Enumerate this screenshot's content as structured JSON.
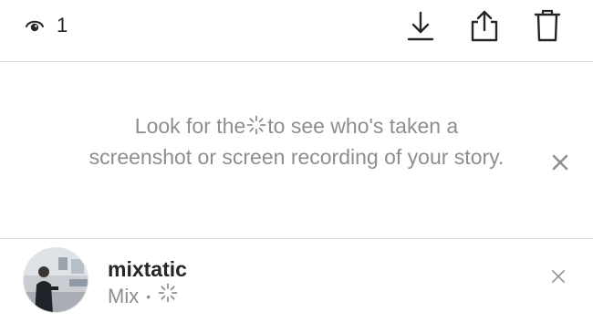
{
  "header": {
    "view_count": "1"
  },
  "notice": {
    "text_before": "Look for the",
    "text_after": "to see who's taken a screenshot or screen recording of your story."
  },
  "viewer": {
    "username": "mixtatic",
    "name": "Mix",
    "separator": "•"
  },
  "icons": {
    "views": "eye-icon",
    "download": "download-icon",
    "share": "share-icon",
    "delete": "trash-icon",
    "screenshot_marker": "screenshot-sparkle-icon",
    "close": "close-icon"
  },
  "colors": {
    "text_primary": "#262626",
    "text_secondary": "#8e8e8e",
    "divider": "#dbdbdb"
  }
}
